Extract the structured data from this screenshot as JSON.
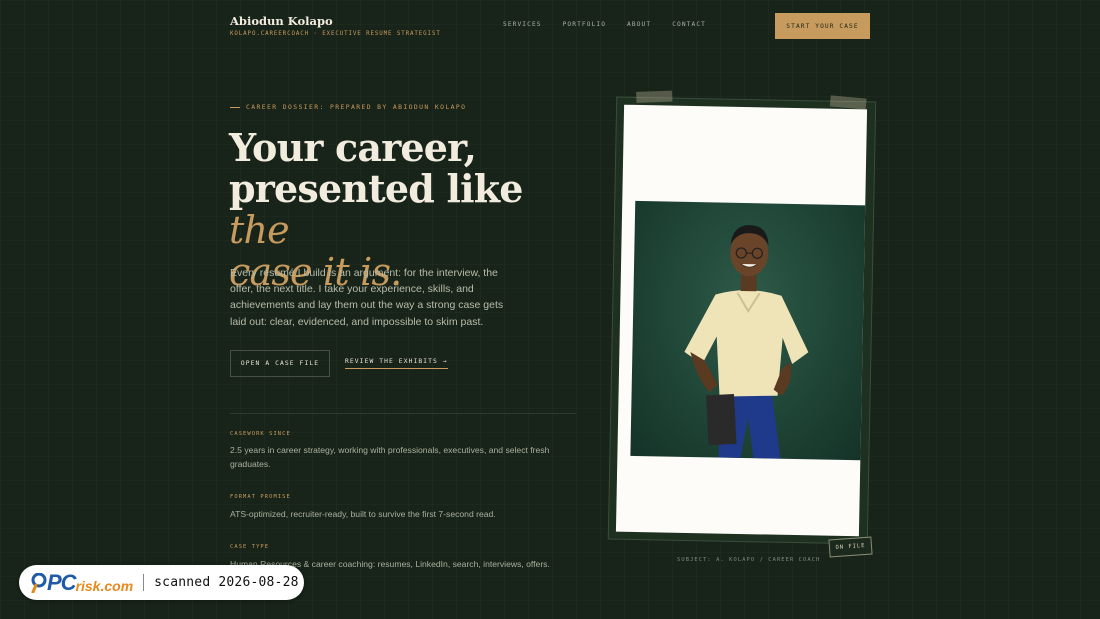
{
  "header": {
    "brand_name": "Abiodun Kolapo",
    "brand_tagline": "KOLAPO.CAREERCOACH · EXECUTIVE RESUME STRATEGIST",
    "nav": [
      "SERVICES",
      "PORTFOLIO",
      "ABOUT",
      "CONTACT"
    ],
    "cta_label": "START YOUR CASE"
  },
  "hero": {
    "kicker": "CAREER DOSSIER: PREPARED BY ABIODUN KOLAPO",
    "headline_line1": "Your career,",
    "headline_line2_plain": "presented like ",
    "headline_line2_accent": "the",
    "headline_line3_accent": "case it is.",
    "lead": "Every résumé I build is an argument: for the interview, the offer, the next title. I take your experience, skills, and achievements and lay them out the way a strong case gets laid out: clear, evidenced, and impossible to skim past.",
    "primary_button": "OPEN A CASE FILE",
    "secondary_link": "REVIEW THE EXHIBITS →"
  },
  "facts": [
    {
      "label": "CASEWORK SINCE",
      "text": "2.5 years in career strategy, working with professionals, executives, and select fresh graduates."
    },
    {
      "label": "FORMAT PROMISE",
      "text": "ATS-optimized, recruiter-ready, built to survive the first 7-second read."
    },
    {
      "label": "CASE TYPE",
      "text": "Human Resources & career coaching: resumes, LinkedIn, search, interviews, offers."
    }
  ],
  "photo": {
    "stamp": "ON FILE",
    "caption": "SUBJECT: A. KOLAPO / CAREER COACH"
  },
  "watermark": {
    "logo_pc": "PC",
    "logo_risk": "risk.com",
    "text": "scanned 2026-08-28"
  },
  "colors": {
    "background": "#182419",
    "accent": "#c79a5e",
    "text": "#f2ecdf"
  }
}
